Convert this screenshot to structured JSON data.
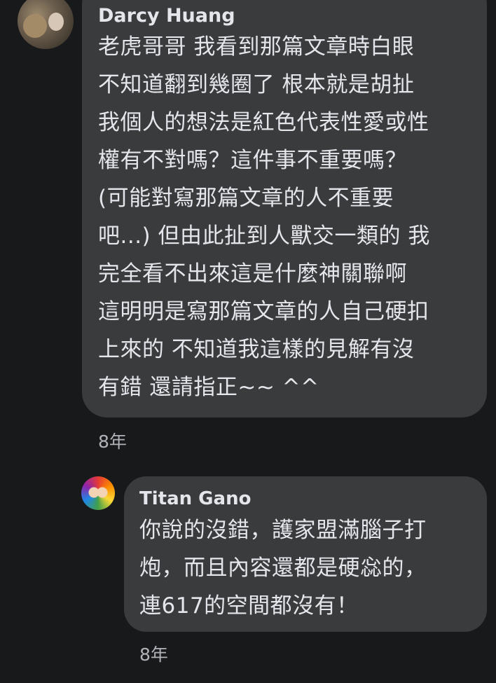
{
  "comment": {
    "author": "Darcy Huang",
    "lines": [
      "老虎哥哥 我看到那篇文章時白眼",
      "不知道翻到幾圈了 根本就是胡扯",
      "我個人的想法是紅色代表性愛或性",
      "權有不對嗎？這件事不重要嗎？",
      "(可能對寫那篇文章的人不重要",
      "吧...) 但由此扯到人獸交一類的 我",
      "完全看不出來這是什麼神關聯啊",
      "這明明是寫那篇文章的人自己硬扣",
      "上來的 不知道我這樣的見解有沒",
      "有錯 還請指正~~ ^^"
    ],
    "time": "8年"
  },
  "reply": {
    "author": "Titan  Gano",
    "lines": [
      "你說的沒錯，護家盟滿腦子打",
      "炮，而且內容還都是硬惢的，",
      "連617的空間都沒有！"
    ],
    "time": "8年"
  }
}
